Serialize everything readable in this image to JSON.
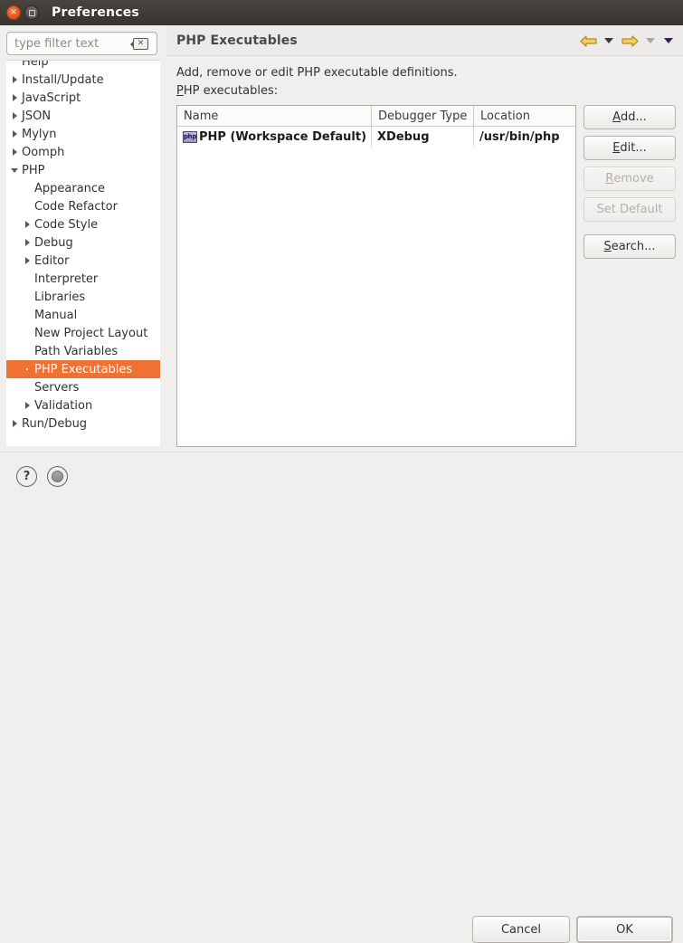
{
  "window": {
    "title": "Preferences",
    "close_icon": "close-icon",
    "maximize_icon": "maximize-icon"
  },
  "sidebar": {
    "filter": {
      "placeholder": "type filter text",
      "value": "",
      "clear_icon": "clear-icon"
    },
    "items": [
      {
        "label": "Help",
        "indent": 1,
        "state": "clipped",
        "selected": false
      },
      {
        "label": "Install/Update",
        "indent": 1,
        "state": "collapsed",
        "selected": false
      },
      {
        "label": "JavaScript",
        "indent": 1,
        "state": "collapsed",
        "selected": false
      },
      {
        "label": "JSON",
        "indent": 1,
        "state": "collapsed",
        "selected": false
      },
      {
        "label": "Mylyn",
        "indent": 1,
        "state": "collapsed",
        "selected": false
      },
      {
        "label": "Oomph",
        "indent": 1,
        "state": "collapsed",
        "selected": false
      },
      {
        "label": "PHP",
        "indent": 1,
        "state": "expanded",
        "selected": false
      },
      {
        "label": "Appearance",
        "indent": 2,
        "state": "leaf",
        "selected": false
      },
      {
        "label": "Code Refactor",
        "indent": 2,
        "state": "leaf",
        "selected": false
      },
      {
        "label": "Code Style",
        "indent": 2,
        "state": "collapsed",
        "selected": false
      },
      {
        "label": "Debug",
        "indent": 2,
        "state": "collapsed",
        "selected": false
      },
      {
        "label": "Editor",
        "indent": 2,
        "state": "collapsed",
        "selected": false
      },
      {
        "label": "Interpreter",
        "indent": 2,
        "state": "leaf",
        "selected": false
      },
      {
        "label": "Libraries",
        "indent": 2,
        "state": "leaf",
        "selected": false
      },
      {
        "label": "Manual",
        "indent": 2,
        "state": "leaf",
        "selected": false
      },
      {
        "label": "New Project Layout",
        "indent": 2,
        "state": "leaf",
        "selected": false
      },
      {
        "label": "Path Variables",
        "indent": 2,
        "state": "leaf",
        "selected": false
      },
      {
        "label": "PHP Executables",
        "indent": 2,
        "state": "leaf",
        "selected": true
      },
      {
        "label": "Servers",
        "indent": 2,
        "state": "leaf",
        "selected": false
      },
      {
        "label": "Validation",
        "indent": 2,
        "state": "collapsed",
        "selected": false
      },
      {
        "label": "Run/Debug",
        "indent": 1,
        "state": "collapsed",
        "selected": false
      }
    ],
    "selection_color": "#f07233"
  },
  "panel": {
    "title": "PHP Executables",
    "description": "Add, remove or edit PHP executable definitions.",
    "list_label": "PHP executables:",
    "list_label_mnemonic": "P",
    "nav": {
      "back_icon": "back-arrow-icon",
      "back_menu_icon": "chevron-down-icon",
      "forward_icon": "forward-arrow-icon",
      "forward_menu_icon": "chevron-down-icon",
      "more_menu_icon": "chevron-down-icon",
      "arrow_color": "#e8b33a"
    }
  },
  "table": {
    "columns": [
      "Name",
      "Debugger Type",
      "Location"
    ],
    "rows": [
      {
        "icon": "php-file-icon",
        "name": "PHP (Workspace Default)",
        "debugger_type": "XDebug",
        "location": "/usr/bin/php"
      }
    ]
  },
  "side_buttons": [
    {
      "label": "Add...",
      "mnemonic": "A",
      "enabled": true
    },
    {
      "label": "Edit...",
      "mnemonic": "E",
      "enabled": true
    },
    {
      "label": "Remove",
      "mnemonic": "R",
      "enabled": false
    },
    {
      "label": "Set Default",
      "mnemonic": "",
      "enabled": false
    },
    {
      "label": "Search...",
      "mnemonic": "S",
      "enabled": true
    }
  ],
  "footer": {
    "help_icon": "help-icon",
    "help_glyph": "?",
    "apply_icon": "apply-circle-icon",
    "cancel_label": "Cancel",
    "ok_label": "OK"
  }
}
